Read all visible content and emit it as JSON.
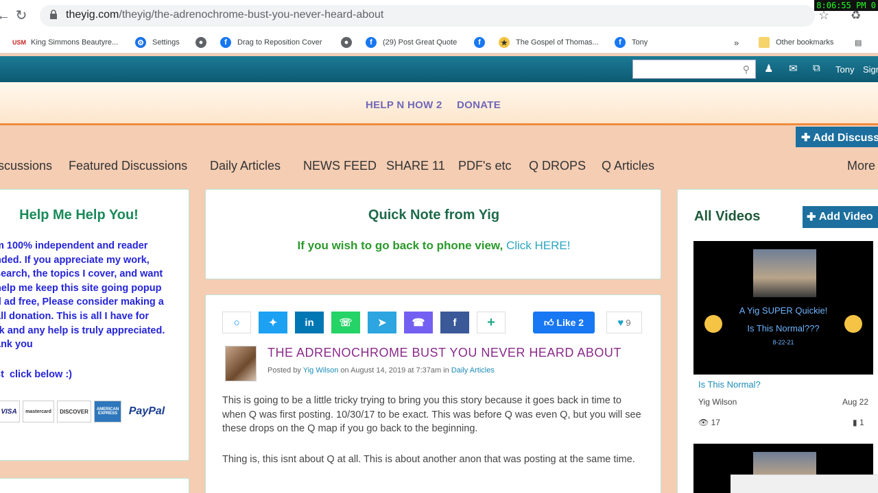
{
  "browser": {
    "url_domain": "theyig.com",
    "url_path": "/theyig/the-adrenochrome-bust-you-never-heard-about",
    "clock": "8:06:55 PM 0"
  },
  "bookmarks": [
    {
      "label": "King Simmons Beautyre..."
    },
    {
      "label": "Settings"
    },
    {
      "label": "Drag to Reposition Cover"
    },
    {
      "label": "(29) Post Great Quote"
    },
    {
      "label": "The Gospel of Thomas..."
    },
    {
      "label": "Tony"
    },
    {
      "label": "Other bookmarks"
    }
  ],
  "site": {
    "user": "Tony",
    "signout": "Sign",
    "menu": {
      "help": "HELP N HOW 2",
      "donate": "DONATE"
    },
    "add_discussion": "Add Discussi",
    "tabs": [
      "scussions",
      "Featured Discussions",
      "Daily Articles",
      "NEWS FEED",
      "SHARE 11",
      "PDF's etc",
      "Q DROPS",
      "Q Articles",
      "More"
    ]
  },
  "help": {
    "title": "Help Me Help You!",
    "text": "m 100% independent and reader\nnded. If you appreciate my work,\nsearch, the topics I cover, and want\nhelp me keep this site going popup\nd ad free, Please consider making a\nall donation. This is all I have for\nrk and any help is truly appreciated.\nank you",
    "below": "st  click below :)",
    "logos": [
      "VISA",
      "mastercard",
      "DISCOVER",
      "AMERICAN EXPRESS",
      "PayPal"
    ]
  },
  "note": {
    "title": "Quick Note from Yig",
    "line": "If you wish to go back to phone view, ",
    "link": "Click HERE!"
  },
  "article": {
    "like": "Like 2",
    "hearts": "9",
    "title": "THE ADRENOCHROME BUST YOU NEVER HEARD ABOUT",
    "posted_by": "Posted by ",
    "author": "Yig Wilson",
    "date": " on August 14, 2019 at 7:37am in ",
    "category": "Daily Articles",
    "p1": "This is going to be a little tricky trying to bring you this story because it goes back in time to when Q was first posting. 10/30/17 to be exact. This was before Q was even Q, but you will see these drops on the Q map if you go back to the beginning.",
    "p2": "Thing is, this isnt about Q at all. This is about another anon that was posting at the same time."
  },
  "videos": {
    "title": "All Videos",
    "add": "Add Video",
    "caption1": "A Yig SUPER Quickie!",
    "caption2": "Is This Normal???",
    "caption3": "8-22-21",
    "link": "Is This Normal?",
    "author": "Yig Wilson",
    "date": "Aug 22",
    "views": "17",
    "comments": "1"
  }
}
